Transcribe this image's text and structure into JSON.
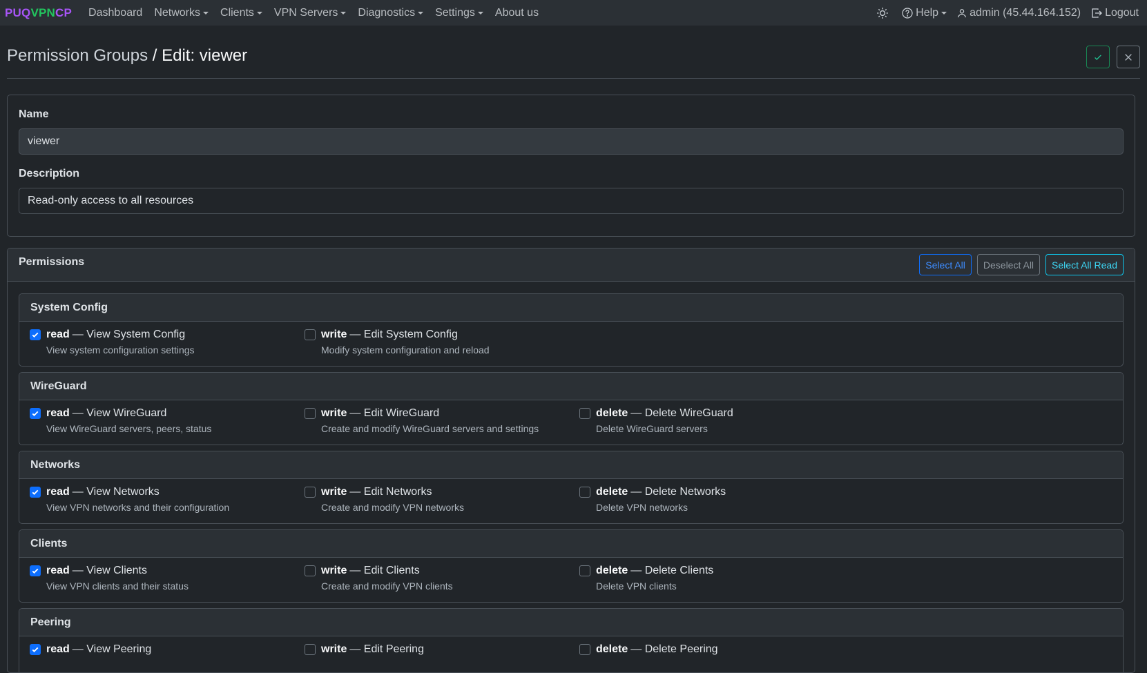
{
  "nav": {
    "brand": [
      "PUQ",
      "VPN",
      "CP"
    ],
    "items": [
      {
        "label": "Dashboard",
        "dropdown": false
      },
      {
        "label": "Networks",
        "dropdown": true
      },
      {
        "label": "Clients",
        "dropdown": true
      },
      {
        "label": "VPN Servers",
        "dropdown": true
      },
      {
        "label": "Diagnostics",
        "dropdown": true
      },
      {
        "label": "Settings",
        "dropdown": true
      },
      {
        "label": "About us",
        "dropdown": false
      }
    ],
    "help": "Help",
    "user": "admin (45.44.164.152)",
    "logout": "Logout"
  },
  "header": {
    "crumb": "Permission Groups",
    "sep": "/",
    "current": "Edit: viewer"
  },
  "form": {
    "name_label": "Name",
    "name_value": "viewer",
    "desc_label": "Description",
    "desc_value": "Read-only access to all resources"
  },
  "permissions": {
    "title": "Permissions",
    "buttons": {
      "select_all": "Select All",
      "deselect_all": "Deselect All",
      "select_all_read": "Select All Read"
    },
    "groups": [
      {
        "name": "System Config",
        "perms": [
          {
            "key": "read",
            "label": "View System Config",
            "desc": "View system configuration settings",
            "checked": true
          },
          {
            "key": "write",
            "label": "Edit System Config",
            "desc": "Modify system configuration and reload",
            "checked": false
          }
        ]
      },
      {
        "name": "WireGuard",
        "perms": [
          {
            "key": "read",
            "label": "View WireGuard",
            "desc": "View WireGuard servers, peers, status",
            "checked": true
          },
          {
            "key": "write",
            "label": "Edit WireGuard",
            "desc": "Create and modify WireGuard servers and settings",
            "checked": false
          },
          {
            "key": "delete",
            "label": "Delete WireGuard",
            "desc": "Delete WireGuard servers",
            "checked": false
          }
        ]
      },
      {
        "name": "Networks",
        "perms": [
          {
            "key": "read",
            "label": "View Networks",
            "desc": "View VPN networks and their configuration",
            "checked": true
          },
          {
            "key": "write",
            "label": "Edit Networks",
            "desc": "Create and modify VPN networks",
            "checked": false
          },
          {
            "key": "delete",
            "label": "Delete Networks",
            "desc": "Delete VPN networks",
            "checked": false
          }
        ]
      },
      {
        "name": "Clients",
        "perms": [
          {
            "key": "read",
            "label": "View Clients",
            "desc": "View VPN clients and their status",
            "checked": true
          },
          {
            "key": "write",
            "label": "Edit Clients",
            "desc": "Create and modify VPN clients",
            "checked": false
          },
          {
            "key": "delete",
            "label": "Delete Clients",
            "desc": "Delete VPN clients",
            "checked": false
          }
        ]
      },
      {
        "name": "Peering",
        "perms": [
          {
            "key": "read",
            "label": "View Peering",
            "checked": true
          },
          {
            "key": "write",
            "label": "Edit Peering",
            "checked": false
          },
          {
            "key": "delete",
            "label": "Delete Peering",
            "checked": false
          }
        ]
      }
    ]
  },
  "colors": {
    "brand_purple": "#a855f7",
    "brand_green": "#22c55e",
    "checkbox_on": "#0d6efd",
    "save": "#198754"
  }
}
